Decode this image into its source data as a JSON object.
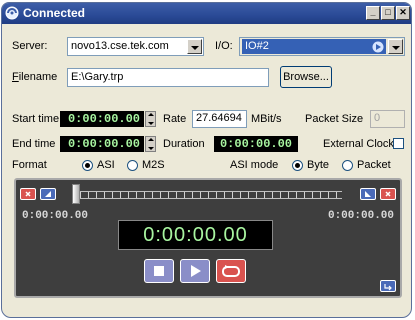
{
  "window": {
    "title": "Connected"
  },
  "server": {
    "label": "Server:",
    "value": "novo13.cse.tek.com"
  },
  "io": {
    "label": "I/O:",
    "value": "IO#2"
  },
  "filename": {
    "label": "Filename",
    "value": "E:\\Gary.trp",
    "browse_label": "Browse..."
  },
  "start_time": {
    "label": "Start time",
    "value": "0:00:00.00"
  },
  "rate": {
    "label": "Rate",
    "value": "27.64694",
    "unit": "MBit/s"
  },
  "packet_size": {
    "label": "Packet Size",
    "value": "0"
  },
  "end_time": {
    "label": "End time",
    "value": "0:00:00.00"
  },
  "duration": {
    "label": "Duration",
    "value": "0:00:00.00"
  },
  "external_clock": {
    "label": "External Clock",
    "checked": false
  },
  "format": {
    "label": "Format",
    "options": [
      "ASI",
      "M2S"
    ],
    "selected": "ASI"
  },
  "asi_mode": {
    "label": "ASI mode",
    "options": [
      "Byte",
      "Packet"
    ],
    "selected": "Byte"
  },
  "player": {
    "left_time": "0:00:00.00",
    "right_time": "0:00:00.00",
    "main_time": "0:00:00.00",
    "position": 0
  },
  "colors": {
    "lcd_text": "#a8f5a0",
    "accent_blue": "#2a4a96",
    "player_bg": "#3e3e3e"
  }
}
